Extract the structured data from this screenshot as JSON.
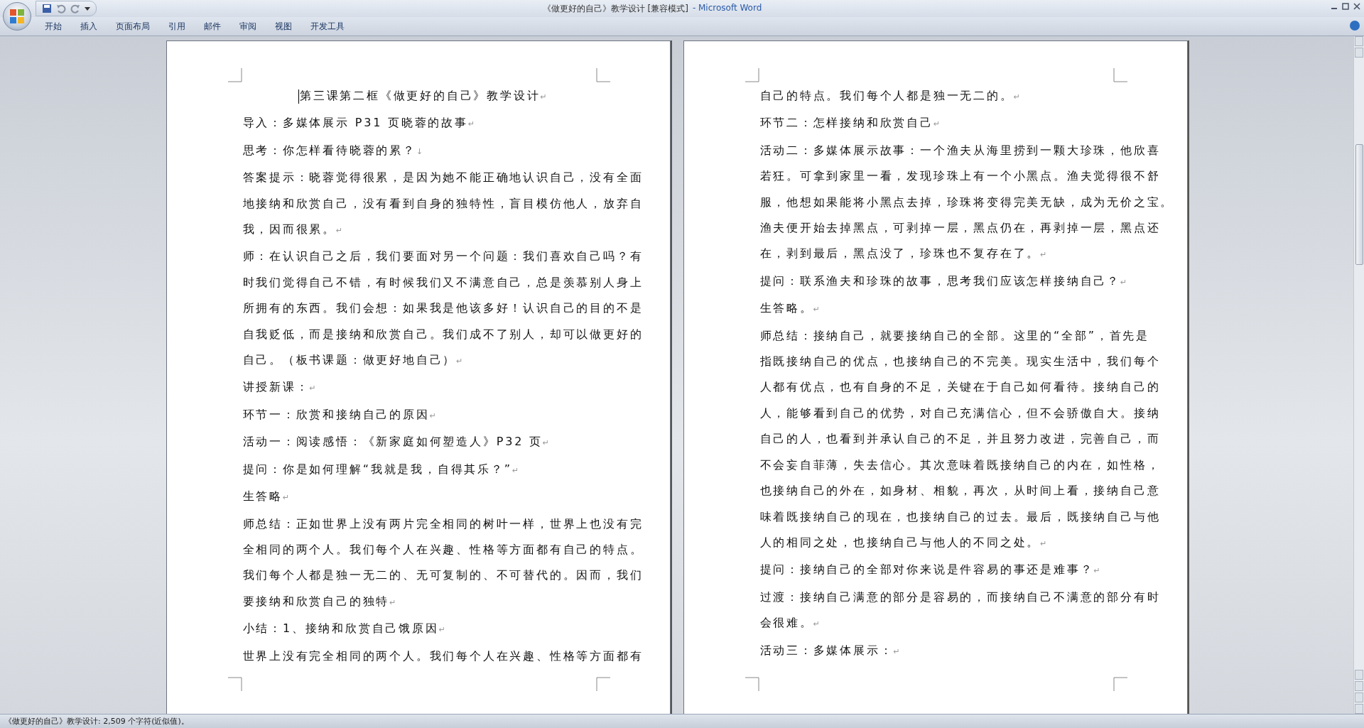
{
  "window": {
    "title": "《做更好的自己》教学设计 [兼容模式]",
    "app_name": "- Microsoft Word"
  },
  "ribbon_tabs": [
    {
      "label": "开始"
    },
    {
      "label": "插入"
    },
    {
      "label": "页面布局"
    },
    {
      "label": "引用"
    },
    {
      "label": "邮件"
    },
    {
      "label": "审阅"
    },
    {
      "label": "视图"
    },
    {
      "label": "开发工具"
    }
  ],
  "pages": [
    {
      "paragraphs": [
        {
          "kind": "title",
          "has_cursor": true,
          "lines": [
            "第三课第二框《做更好的自己》教学设计"
          ],
          "end_mark": "↵"
        },
        {
          "kind": "body",
          "has_cursor": false,
          "lines": [
            "导入：多媒体展示 P31 页晓蓉的故事"
          ],
          "end_mark": "↵"
        },
        {
          "kind": "body",
          "has_cursor": false,
          "lines": [
            "思考：你怎样看待晓蓉的累？"
          ],
          "end_mark": "↓"
        },
        {
          "kind": "body",
          "has_cursor": false,
          "lines": [
            "答案提示：晓蓉觉得很累，是因为她不能正确地认识自己，没有全面",
            "地接纳和欣赏自己，没有看到自身的独特性，盲目模仿他人，放弃自",
            "我，因而很累。"
          ],
          "end_mark": "↵"
        },
        {
          "kind": "body",
          "has_cursor": false,
          "lines": [
            "师：在认识自己之后，我们要面对另一个问题：我们喜欢自己吗？有",
            "时我们觉得自己不错，有时候我们又不满意自己，总是羡慕别人身上",
            "所拥有的东西。我们会想：如果我是他该多好！认识自己的目的不是",
            "自我贬低，而是接纳和欣赏自己。我们成不了别人，却可以做更好的",
            "自己。（板书课题：做更好地自己）"
          ],
          "end_mark": "↵"
        },
        {
          "kind": "body",
          "has_cursor": false,
          "lines": [
            "讲授新课："
          ],
          "end_mark": "↵"
        },
        {
          "kind": "body",
          "has_cursor": false,
          "lines": [
            "环节一：欣赏和接纳自己的原因"
          ],
          "end_mark": "↵"
        },
        {
          "kind": "body",
          "has_cursor": false,
          "lines": [
            "活动一：阅读感悟：《新家庭如何塑造人》P32 页"
          ],
          "end_mark": "↵"
        },
        {
          "kind": "body",
          "has_cursor": false,
          "lines": [
            "提问：你是如何理解“我就是我，自得其乐？”"
          ],
          "end_mark": "↵"
        },
        {
          "kind": "body",
          "has_cursor": false,
          "lines": [
            "生答略"
          ],
          "end_mark": "↵"
        },
        {
          "kind": "body",
          "has_cursor": false,
          "lines": [
            "师总结：正如世界上没有两片完全相同的树叶一样，世界上也没有完",
            "全相同的两个人。我们每个人在兴趣、性格等方面都有自己的特点。",
            "我们每个人都是独一无二的、无可复制的、不可替代的。因而，我们",
            "要接纳和欣赏自己的独特"
          ],
          "end_mark": "↵"
        },
        {
          "kind": "body",
          "has_cursor": false,
          "lines": [
            "小结：1、接纳和欣赏自己饿原因"
          ],
          "end_mark": "↵"
        },
        {
          "kind": "body",
          "has_cursor": false,
          "lines": [
            "世界上没有完全相同的两个人。我们每个人在兴趣、性格等方面都有"
          ]
        }
      ]
    },
    {
      "paragraphs": [
        {
          "kind": "body",
          "has_cursor": false,
          "lines": [
            "自己的特点。我们每个人都是独一无二的。"
          ],
          "end_mark": "↵"
        },
        {
          "kind": "body",
          "has_cursor": false,
          "lines": [
            "环节二：怎样接纳和欣赏自己"
          ],
          "end_mark": "↵"
        },
        {
          "kind": "body",
          "has_cursor": false,
          "lines": [
            "活动二：多媒体展示故事：一个渔夫从海里捞到一颗大珍珠，他欣喜",
            "若狂。可拿到家里一看，发现珍珠上有一个小黑点。渔夫觉得很不舒",
            "服，他想如果能将小黑点去掉，珍珠将变得完美无缺，成为无价之宝。",
            "渔夫便开始去掉黑点，可剥掉一层，黑点仍在，再剥掉一层，黑点还",
            "在，剥到最后，黑点没了，珍珠也不复存在了。"
          ],
          "end_mark": "↵"
        },
        {
          "kind": "body",
          "has_cursor": false,
          "lines": [
            "提问：联系渔夫和珍珠的故事，思考我们应该怎样接纳自己？"
          ],
          "end_mark": "↵"
        },
        {
          "kind": "body",
          "has_cursor": false,
          "lines": [
            "生答略。"
          ],
          "end_mark": "↵"
        },
        {
          "kind": "body",
          "has_cursor": false,
          "lines": [
            "师总结：接纳自己，就要接纳自己的全部。这里的“全部”，首先是",
            "指既接纳自己的优点，也接纳自己的不完美。现实生活中，我们每个",
            "人都有优点，也有自身的不足，关键在于自己如何看待。接纳自己的",
            "人，能够看到自己的优势，对自己充满信心，但不会骄傲自大。接纳",
            "自己的人，也看到并承认自己的不足，并且努力改进，完善自己，而",
            "不会妄自菲薄，失去信心。其次意味着既接纳自己的内在，如性格，",
            "也接纳自己的外在，如身材、相貌，再次，从时间上看，接纳自己意",
            "味着既接纳自己的现在，也接纳自己的过去。最后，既接纳自己与他",
            "人的相同之处，也接纳自己与他人的不同之处。"
          ],
          "end_mark": "↵"
        },
        {
          "kind": "body",
          "has_cursor": false,
          "lines": [
            "提问：接纳自己的全部对你来说是件容易的事还是难事？"
          ],
          "end_mark": "↵"
        },
        {
          "kind": "body",
          "has_cursor": false,
          "lines": [
            "过渡：接纳自己满意的部分是容易的，而接纳自己不满意的部分有时",
            "会很难。"
          ],
          "end_mark": "↵"
        },
        {
          "kind": "body",
          "has_cursor": false,
          "lines": [
            "活动三：多媒体展示："
          ],
          "end_mark": "↵"
        }
      ]
    }
  ],
  "status_bar": {
    "text": "《做更好的自己》教学设计: 2,509 个字符(近似值)。"
  }
}
